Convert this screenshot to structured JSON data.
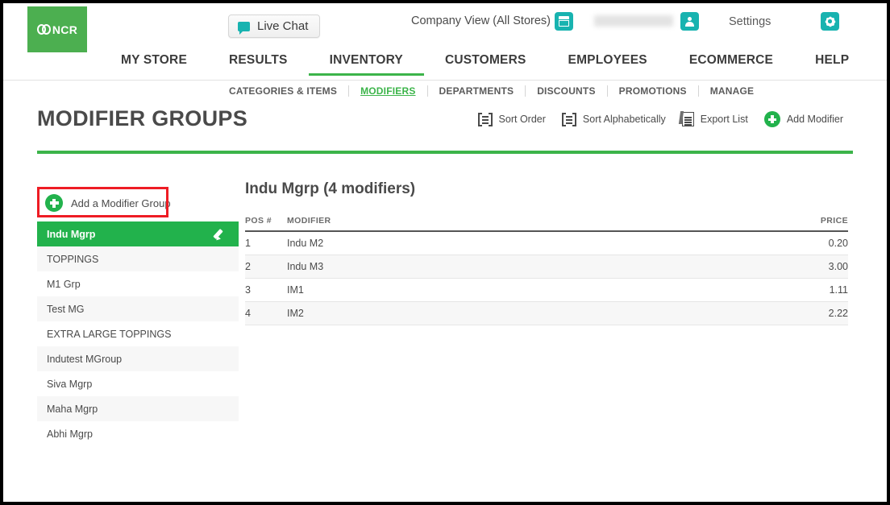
{
  "brand": {
    "logo_text": "NCR",
    "logo_bg": "#4caf50",
    "accent_green": "#3cb44a",
    "accent_teal": "#18b3b0",
    "highlight_red": "#ee1c24"
  },
  "topbar": {
    "live_chat_label": "Live Chat",
    "live_chat_icon": "chat-bubble-icon",
    "company_view_label": "Company View (All Stores)",
    "store_icon": "store-icon",
    "user_name_redacted": "",
    "user_icon": "user-icon",
    "settings_label": "Settings",
    "gear_icon": "gear-icon"
  },
  "mainnav": {
    "items": [
      {
        "label": "MY STORE",
        "active": false
      },
      {
        "label": "RESULTS",
        "active": false
      },
      {
        "label": "INVENTORY",
        "active": true
      },
      {
        "label": "CUSTOMERS",
        "active": false
      },
      {
        "label": "EMPLOYEES",
        "active": false
      },
      {
        "label": "ECOMMERCE",
        "active": false
      },
      {
        "label": "HELP",
        "active": false
      }
    ]
  },
  "subnav": {
    "items": [
      {
        "label": "CATEGORIES & ITEMS",
        "active": false
      },
      {
        "label": "MODIFIERS",
        "active": true
      },
      {
        "label": "DEPARTMENTS",
        "active": false
      },
      {
        "label": "DISCOUNTS",
        "active": false
      },
      {
        "label": "PROMOTIONS",
        "active": false
      },
      {
        "label": "MANAGE",
        "active": false
      }
    ]
  },
  "page": {
    "title": "MODIFIER GROUPS"
  },
  "toolbar": {
    "sort_order_label": "Sort Order",
    "sort_order_icon": "sort-order-icon",
    "sort_alphabetically_label": "Sort Alphabetically",
    "sort_alphabetically_icon": "sort-alphabetical-icon",
    "export_list_label": "Export List",
    "export_list_icon": "document-icon",
    "add_modifier_label": "Add Modifier",
    "add_modifier_icon": "plus-circle-icon"
  },
  "sidebar": {
    "add_group_label": "Add a Modifier Group",
    "add_group_icon": "plus-circle-icon",
    "edit_icon": "pencil-icon",
    "items": [
      {
        "label": "Indu Mgrp",
        "selected": true
      },
      {
        "label": "TOPPINGS",
        "selected": false
      },
      {
        "label": "M1 Grp",
        "selected": false
      },
      {
        "label": "Test MG",
        "selected": false
      },
      {
        "label": "EXTRA LARGE TOPPINGS",
        "selected": false
      },
      {
        "label": "Indutest MGroup",
        "selected": false
      },
      {
        "label": "Siva Mgrp",
        "selected": false
      },
      {
        "label": "Maha Mgrp",
        "selected": false
      },
      {
        "label": "Abhi Mgrp",
        "selected": false
      }
    ]
  },
  "detail": {
    "title": "Indu Mgrp (4 modifiers)",
    "columns": {
      "pos": "POS #",
      "modifier": "MODIFIER",
      "price": "PRICE"
    },
    "rows": [
      {
        "pos": "1",
        "modifier": "Indu M2",
        "price": "0.20"
      },
      {
        "pos": "2",
        "modifier": "Indu M3",
        "price": "3.00"
      },
      {
        "pos": "3",
        "modifier": "IM1",
        "price": "1.11"
      },
      {
        "pos": "4",
        "modifier": "IM2",
        "price": "2.22"
      }
    ]
  }
}
